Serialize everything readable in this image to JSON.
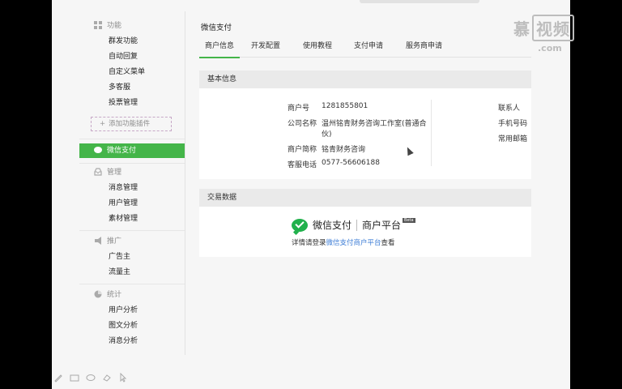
{
  "watermark": {
    "word": "慕课视频",
    "brand": "慕",
    "box": "视频",
    "domain": ".com"
  },
  "sidebar": {
    "group_function": {
      "title": "功能",
      "items": [
        "群发功能",
        "自动回复",
        "自定义菜单",
        "多客服",
        "投票管理"
      ]
    },
    "add_plugin": "添加功能插件",
    "active": "微信支付",
    "group_manage": {
      "title": "管理",
      "items": [
        "消息管理",
        "用户管理",
        "素材管理"
      ]
    },
    "group_promo": {
      "title": "推广",
      "items": [
        "广告主",
        "流量主"
      ]
    },
    "group_stats": {
      "title": "统计",
      "items": [
        "用户分析",
        "图文分析",
        "消息分析"
      ]
    }
  },
  "main": {
    "title": "微信支付",
    "tabs": [
      "商户信息",
      "开发配置",
      "使用教程",
      "支付申请",
      "服务商申请"
    ],
    "basic_info": {
      "head": "基本信息",
      "rows": [
        {
          "label": "商户号",
          "value": "1281855801"
        },
        {
          "label": "公司名称",
          "value_line1": "温州铭青财务咨询工作室(普通合",
          "value_line2": "伙)"
        },
        {
          "label": "商户简称",
          "value": "铭青财务咨询"
        },
        {
          "label": "客服电话",
          "value": "0577-56606188"
        }
      ],
      "right_labels": [
        "联系人",
        "手机号码",
        "常用邮箱"
      ]
    },
    "trade": {
      "head": "交易数据",
      "logo_primary": "微信支付",
      "logo_secondary": "商户平台",
      "beta": "Beta",
      "hint_prefix": "详情请登录",
      "hint_link": "微信支付商户平台",
      "hint_suffix": "查看"
    }
  },
  "colors": {
    "accent": "#44b549",
    "link": "#3a7bd5",
    "header_bg": "#eaeaea"
  }
}
